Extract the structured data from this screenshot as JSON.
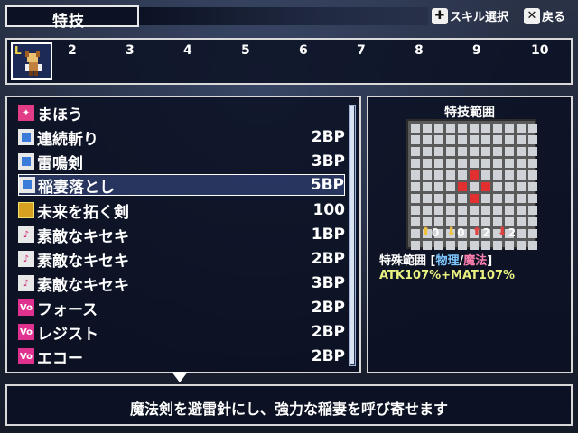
{
  "header": {
    "title": "特技",
    "help_select": "スキル選択",
    "help_back": "戻る"
  },
  "party": {
    "level_badge": "L",
    "slots": [
      "2",
      "3",
      "4",
      "5",
      "6",
      "7",
      "8",
      "9",
      "10"
    ]
  },
  "skills": [
    {
      "name": "まほう",
      "cost": "",
      "icon": "wand-icon"
    },
    {
      "name": "連続斬り",
      "cost": "2BP",
      "icon": "skill-icon"
    },
    {
      "name": "雷鳴剣",
      "cost": "3BP",
      "icon": "skill-icon"
    },
    {
      "name": "稲妻落とし",
      "cost": "5BP",
      "icon": "skill-icon"
    },
    {
      "name": "未来を拓く剣",
      "cost": "100",
      "icon": "gold-skill-icon"
    },
    {
      "name": "素敵なキセキ",
      "cost": "1BP",
      "icon": "note-icon"
    },
    {
      "name": "素敵なキセキ",
      "cost": "2BP",
      "icon": "note-icon"
    },
    {
      "name": "素敵なキセキ",
      "cost": "3BP",
      "icon": "note-icon"
    },
    {
      "name": "フォース",
      "cost": "2BP",
      "icon": "voice-icon"
    },
    {
      "name": "レジスト",
      "cost": "2BP",
      "icon": "voice-icon"
    },
    {
      "name": "エコー",
      "cost": "2BP",
      "icon": "voice-icon"
    }
  ],
  "selected_index": 3,
  "range": {
    "title": "特技範囲",
    "stats": [
      "0",
      "0",
      "2",
      "2"
    ],
    "special_label": "特殊範囲 [",
    "phys": "物理",
    "slash": "/",
    "mag": "魔法",
    "close": "]",
    "formula": "ATK107%+MAT107%"
  },
  "description": "魔法剣を避雷針にし、強力な稲妻を呼び寄せます"
}
